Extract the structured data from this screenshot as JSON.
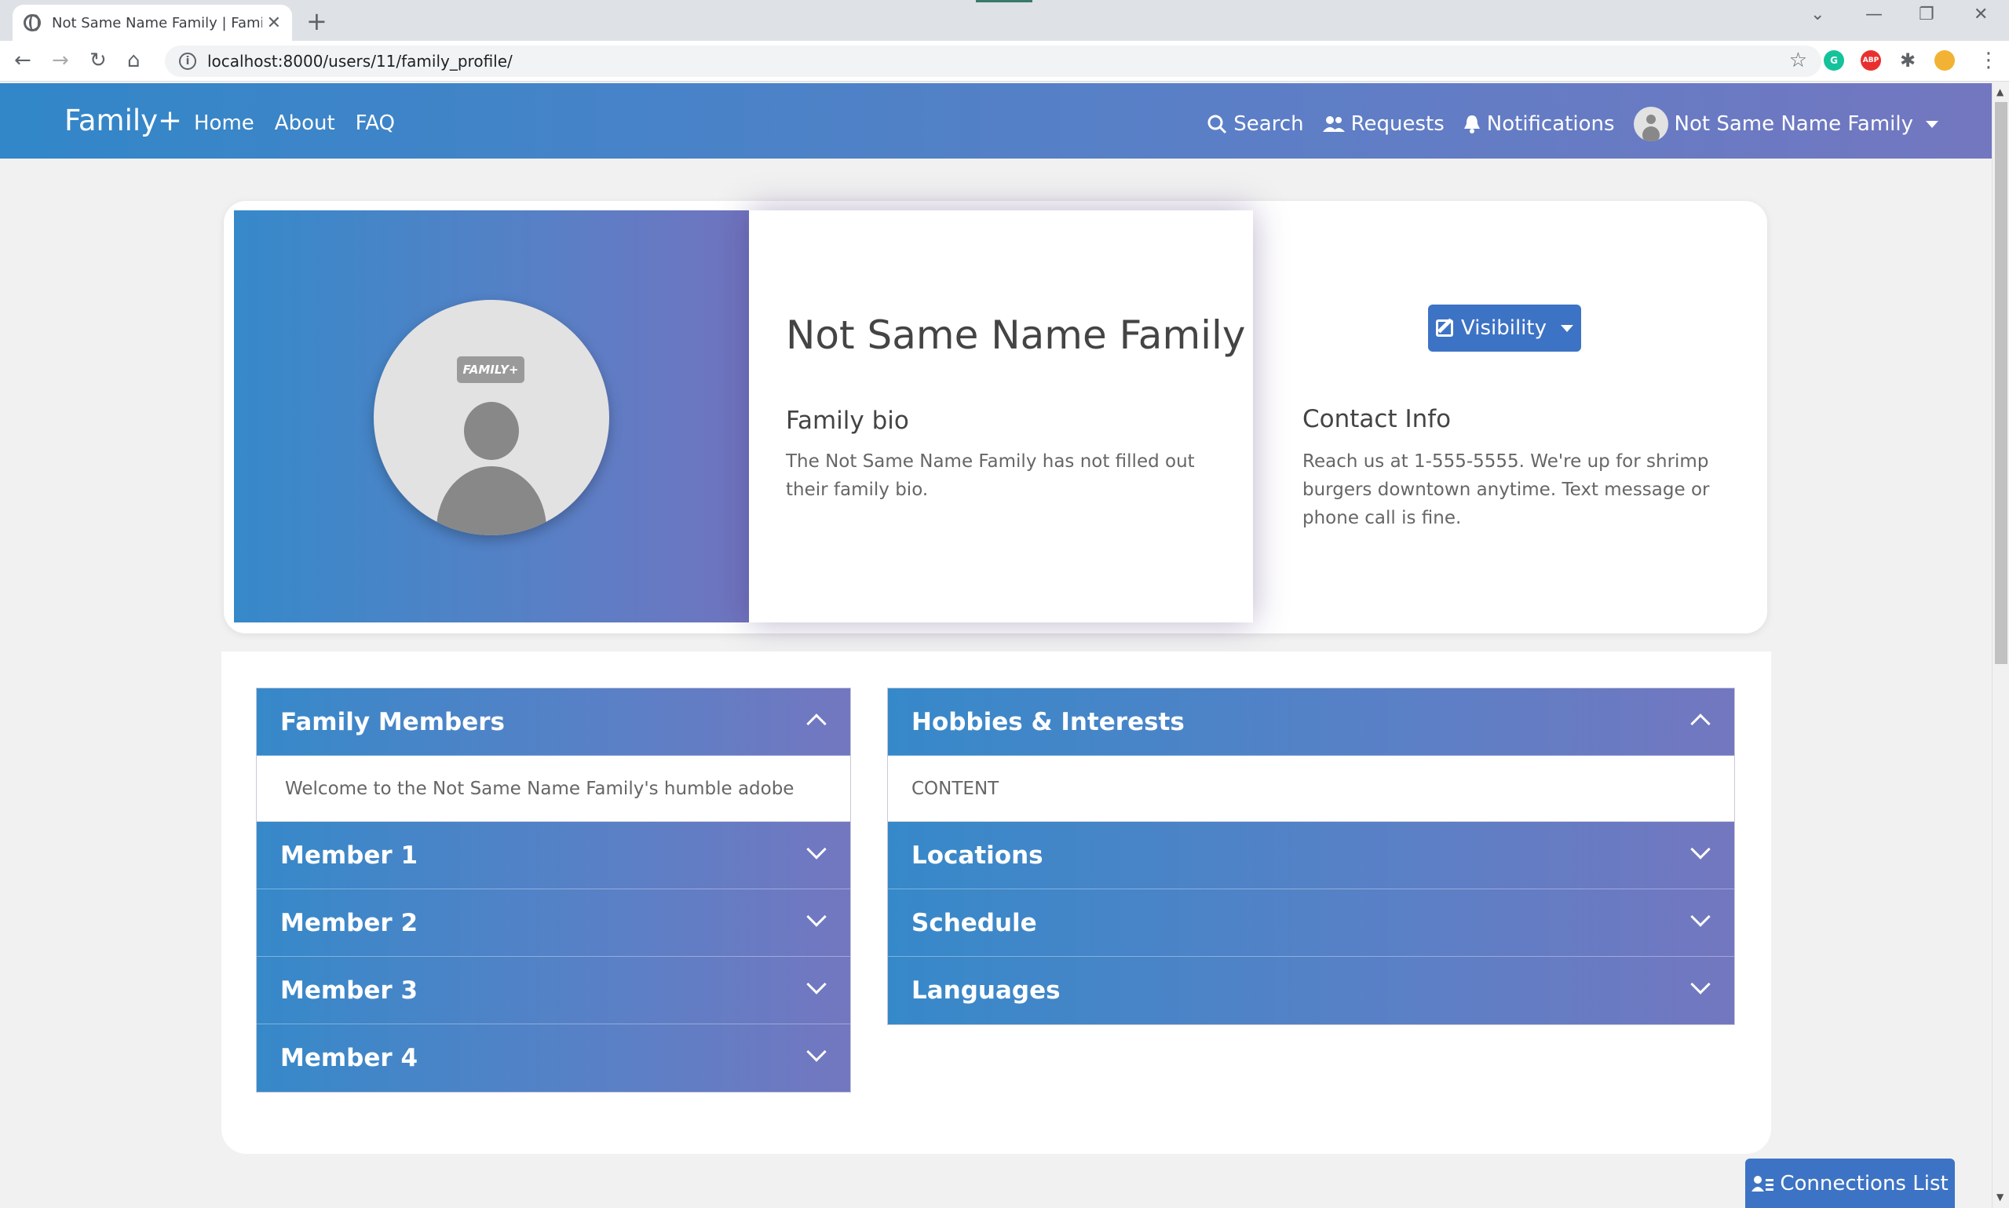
{
  "browser": {
    "tab_title": "Not Same Name Family | Family+",
    "tab_close": "✕",
    "new_tab": "+",
    "url": "localhost:8000/users/11/family_profile/",
    "nav": {
      "back": "←",
      "forward": "→",
      "reload": "↻",
      "home": "⌂"
    },
    "window": {
      "chevron": "⌄",
      "minimize": "—",
      "restore": "❐",
      "close": "✕"
    },
    "menu": "⋮",
    "star": "☆",
    "extensions": [
      "grammarly-icon",
      "adblock-icon",
      "puzzle-icon",
      "profile-extension-icon"
    ],
    "ext_labels": {
      "grammarly": "G",
      "adblock": "ABP",
      "puzzle": "✱"
    }
  },
  "navbar": {
    "brand": "Family+",
    "links": [
      "Home",
      "About",
      "FAQ"
    ],
    "search": "Search",
    "requests": "Requests",
    "notifications": "Notifications",
    "user": "Not Same Name Family"
  },
  "profile": {
    "avatar_tag": "FAMILY+",
    "name": "Not Same Name Family",
    "bio_title": "Family bio",
    "bio_text": "The Not Same Name Family has not filled out their family bio.",
    "visibility_button": "Visibility",
    "contact_title": "Contact Info",
    "contact_text": "Reach us at 1-555-5555. We're up for shrimp burgers downtown anytime. Text message or phone call is fine."
  },
  "family_accordion": {
    "header": "Family Members",
    "welcome": "Welcome to the Not Same Name Family's humble adobe",
    "members": [
      "Member 1",
      "Member 2",
      "Member 3",
      "Member 4"
    ]
  },
  "info_accordion": {
    "header": "Hobbies & Interests",
    "content": "CONTENT",
    "sections": [
      "Locations",
      "Schedule",
      "Languages"
    ]
  },
  "connections_button": "Connections List",
  "colors": {
    "gradient_start": "#3187c8",
    "gradient_end": "#7377c0",
    "button_blue": "#3d73c4"
  }
}
